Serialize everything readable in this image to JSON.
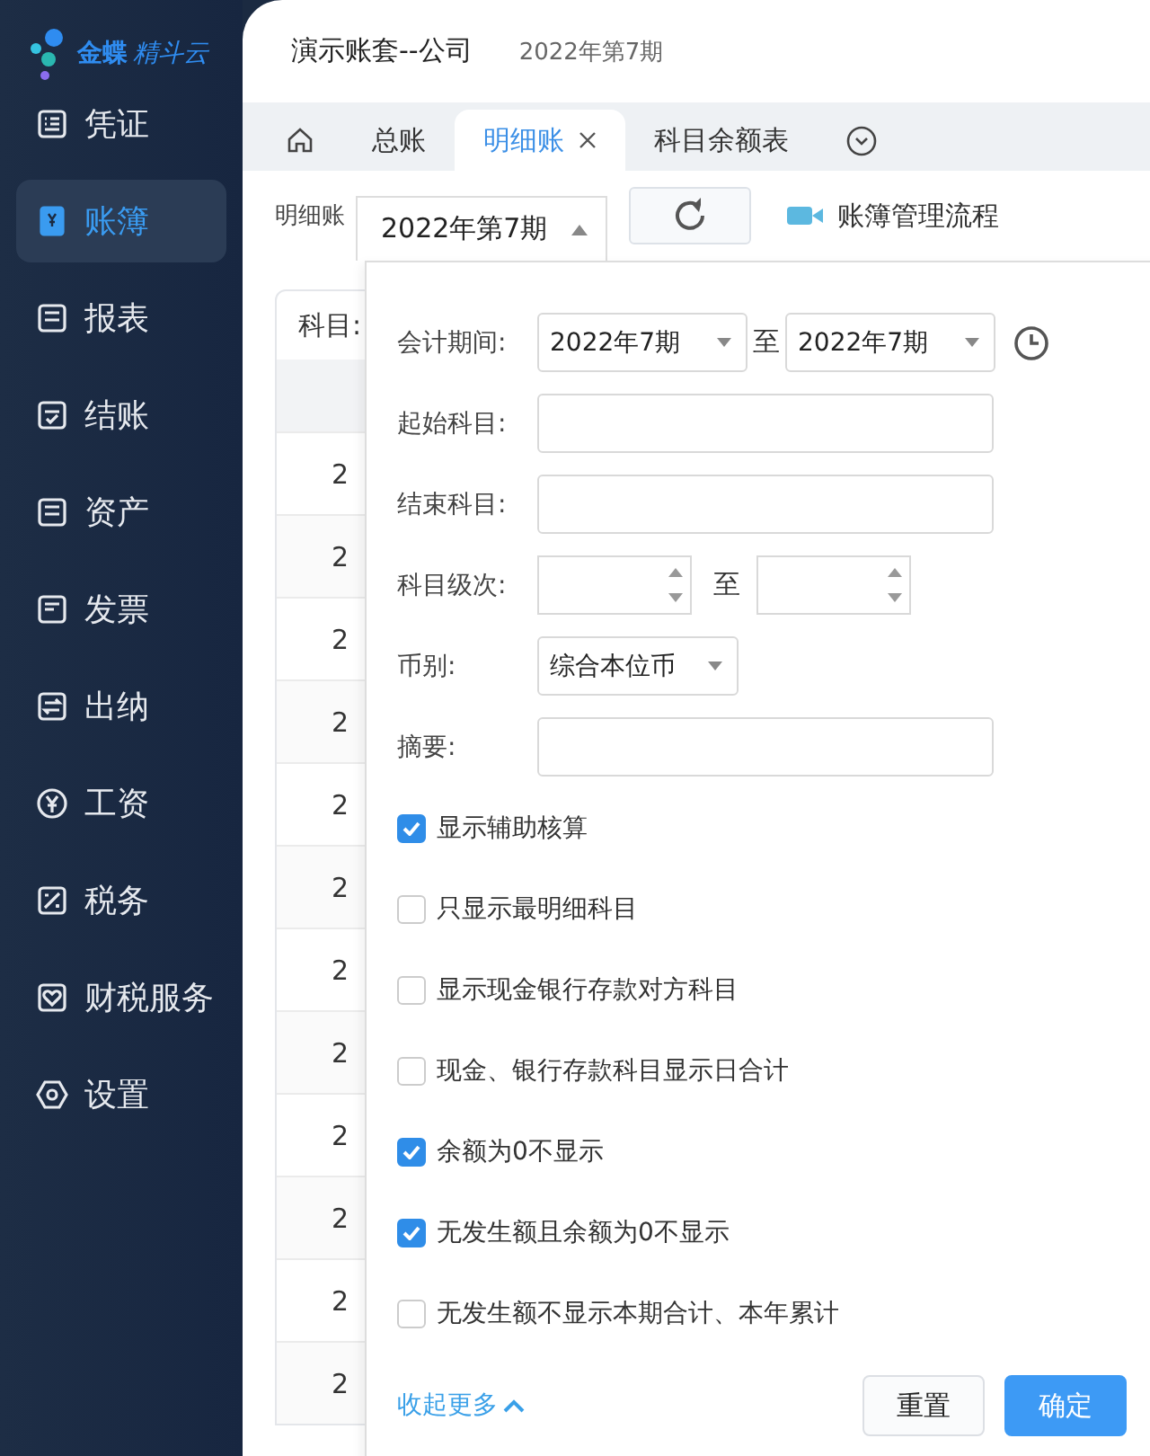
{
  "logo": {
    "brand": "金蝶",
    "product": "精斗云"
  },
  "sidebar": {
    "items": [
      {
        "label": "凭证",
        "selected": false
      },
      {
        "label": "账簿",
        "selected": true
      },
      {
        "label": "报表",
        "selected": false
      },
      {
        "label": "结账",
        "selected": false
      },
      {
        "label": "资产",
        "selected": false
      },
      {
        "label": "发票",
        "selected": false
      },
      {
        "label": "出纳",
        "selected": false
      },
      {
        "label": "工资",
        "selected": false
      },
      {
        "label": "税务",
        "selected": false
      },
      {
        "label": "财税服务",
        "selected": false
      },
      {
        "label": "设置",
        "selected": false
      }
    ]
  },
  "header": {
    "account": "演示账套--公司",
    "period": "2022年第7期"
  },
  "tabs": [
    {
      "kind": "home",
      "selected": false
    },
    {
      "kind": "text",
      "label": "总账",
      "selected": false,
      "closable": false
    },
    {
      "kind": "text",
      "label": "明细账",
      "selected": true,
      "closable": true
    },
    {
      "kind": "text",
      "label": "科目余额表",
      "selected": false,
      "closable": false
    },
    {
      "kind": "more",
      "selected": false
    }
  ],
  "toolbar": {
    "label": "明细账",
    "period": "2022年第7期",
    "link": "账簿管理流程"
  },
  "table": {
    "subject_label": "科目:",
    "rows": [
      "2",
      "2",
      "2",
      "2",
      "2",
      "2",
      "2",
      "2",
      "2",
      "2",
      "2",
      "2"
    ]
  },
  "filter_panel": {
    "rows": [
      {
        "kind": "range_select",
        "label": "会计期间:",
        "from": "2022年7期",
        "separator": "至",
        "to": "2022年7期"
      },
      {
        "kind": "input",
        "label": "起始科目:"
      },
      {
        "kind": "input",
        "label": "结束科目:"
      },
      {
        "kind": "number_range",
        "label": "科目级次:",
        "separator": "至"
      },
      {
        "kind": "select",
        "label": "币别:",
        "value": "综合本位币"
      },
      {
        "kind": "input",
        "label": "摘要:"
      }
    ],
    "options": [
      {
        "label": "显示辅助核算",
        "checked": true
      },
      {
        "label": "只显示最明细科目",
        "checked": false
      },
      {
        "label": "显示现金银行存款对方科目",
        "checked": false
      },
      {
        "label": "现金、银行存款科目显示日合计",
        "checked": false
      },
      {
        "label": "余额为0不显示",
        "checked": true
      },
      {
        "label": "无发生额且余额为0不显示",
        "checked": true
      },
      {
        "label": "无发生额不显示本期合计、本年累计",
        "checked": false
      }
    ],
    "collapse_link": "收起更多",
    "buttons": [
      {
        "label": "重置",
        "kind": "secondary"
      },
      {
        "label": "确定",
        "kind": "primary"
      }
    ]
  }
}
